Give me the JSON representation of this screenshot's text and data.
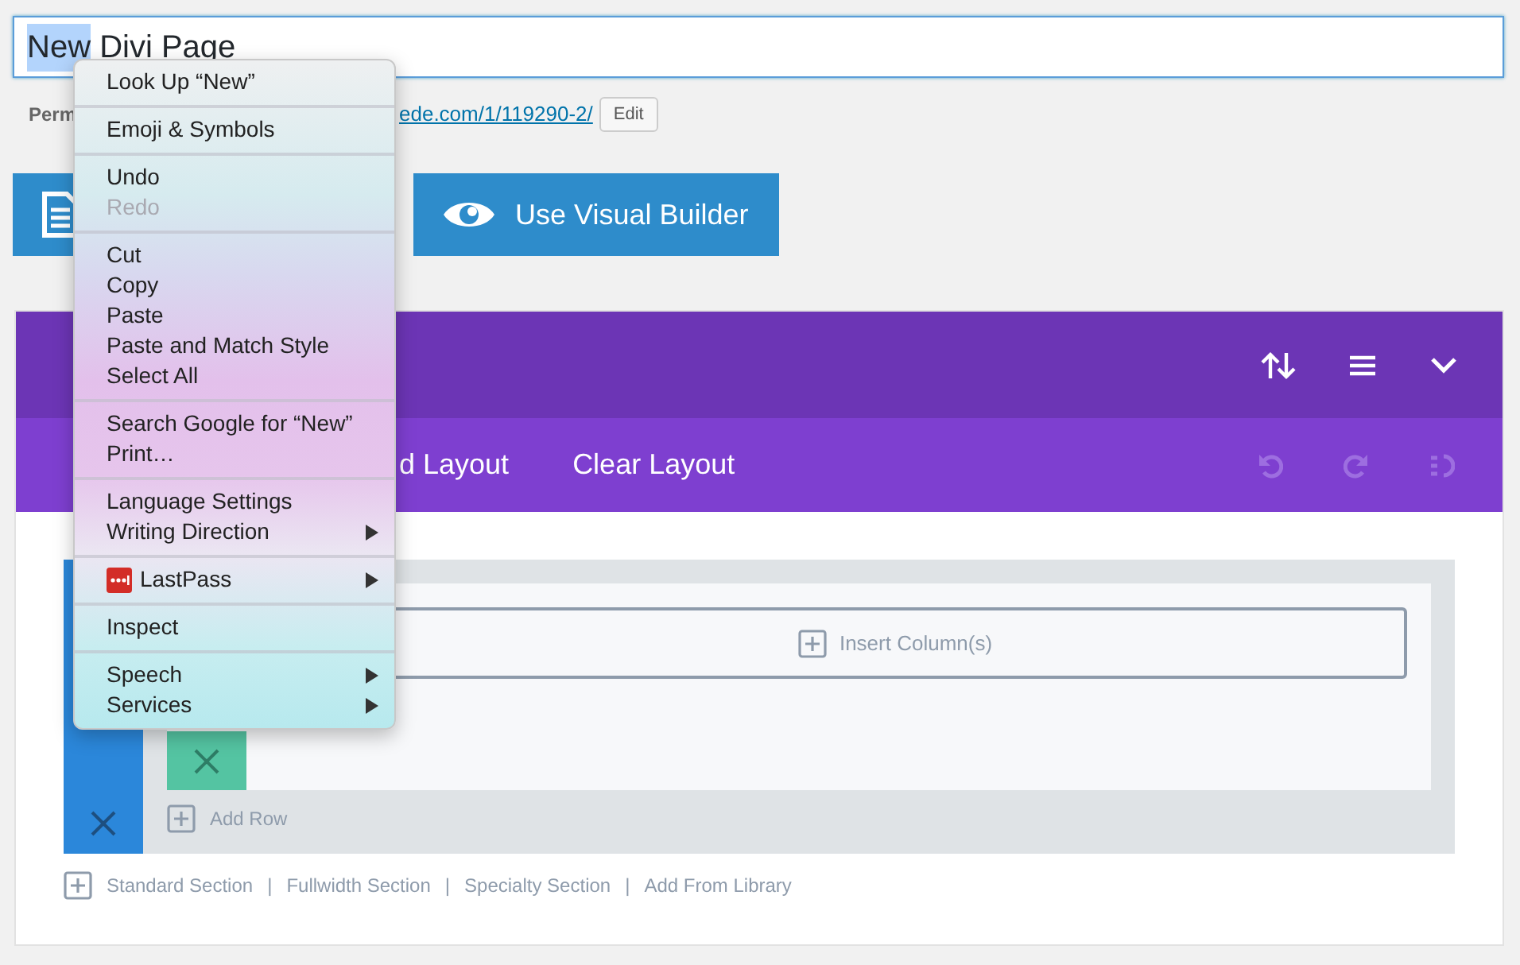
{
  "title_field": {
    "selected_text": "New",
    "rest_text": "Divi Page"
  },
  "permalink": {
    "label": "Perm",
    "url": "ede.com/1/119290-2/",
    "edit_button": "Edit"
  },
  "builder_button": "Use Visual Builder",
  "layout_bar": [
    "d Layout",
    "Clear Layout"
  ],
  "section": {
    "insert_column": "Insert Column(s)",
    "add_row": "Add Row"
  },
  "section_links": {
    "items": [
      "Standard Section",
      "Fullwidth Section",
      "Specialty Section",
      "Add From Library"
    ],
    "separator": "|"
  },
  "context_menu": [
    [
      {
        "label": "Look Up “New”",
        "disabled": false,
        "submenu": false
      }
    ],
    [
      {
        "label": "Emoji & Symbols",
        "disabled": false,
        "submenu": false
      }
    ],
    [
      {
        "label": "Undo",
        "disabled": false,
        "submenu": false
      },
      {
        "label": "Redo",
        "disabled": true,
        "submenu": false
      }
    ],
    [
      {
        "label": "Cut",
        "disabled": false,
        "submenu": false
      },
      {
        "label": "Copy",
        "disabled": false,
        "submenu": false
      },
      {
        "label": "Paste",
        "disabled": false,
        "submenu": false
      },
      {
        "label": "Paste and Match Style",
        "disabled": false,
        "submenu": false
      },
      {
        "label": "Select All",
        "disabled": false,
        "submenu": false
      }
    ],
    [
      {
        "label": "Search Google for “New”",
        "disabled": false,
        "submenu": false
      },
      {
        "label": "Print…",
        "disabled": false,
        "submenu": false
      }
    ],
    [
      {
        "label": "Language Settings",
        "disabled": false,
        "submenu": false
      },
      {
        "label": "Writing Direction",
        "disabled": false,
        "submenu": true
      }
    ],
    [
      {
        "label": "LastPass",
        "disabled": false,
        "submenu": true,
        "kind": "extension"
      }
    ],
    [
      {
        "label": "Inspect",
        "disabled": false,
        "submenu": false
      }
    ],
    [
      {
        "label": "Speech",
        "disabled": false,
        "submenu": true
      },
      {
        "label": "Services",
        "disabled": false,
        "submenu": true
      }
    ]
  ]
}
